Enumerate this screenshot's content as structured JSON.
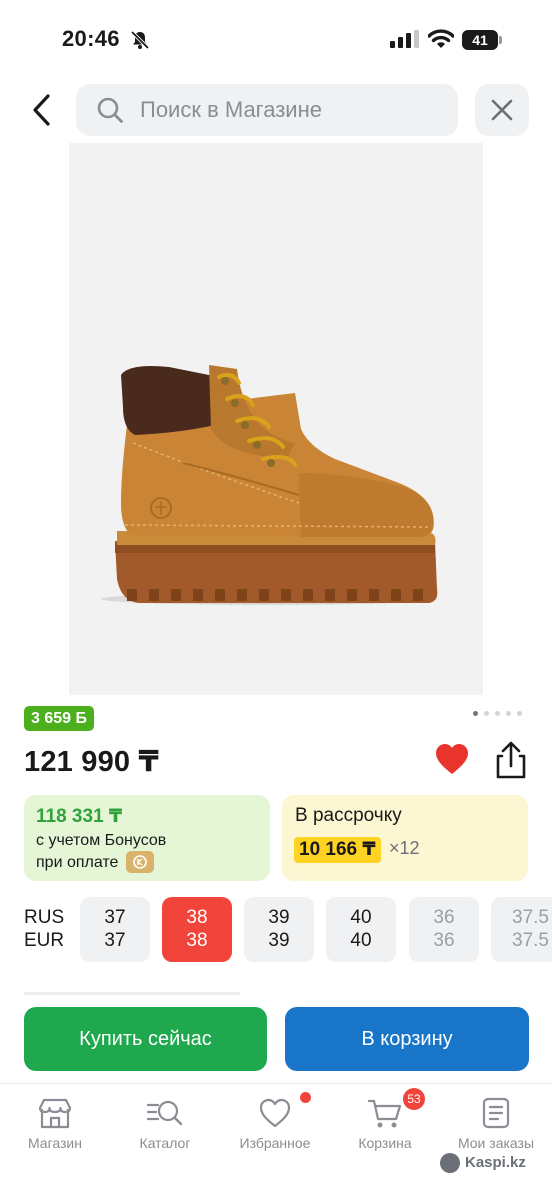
{
  "status_bar": {
    "time": "20:46",
    "battery": "41"
  },
  "search": {
    "placeholder": "Поиск в Магазине"
  },
  "product": {
    "bonus_badge": "3 659 Б",
    "price": "121 990 ₸",
    "gallery_dots": 5,
    "gallery_active": 0
  },
  "bonus_card": {
    "price": "118 331 ₸",
    "line1": "с учетом Бонусов",
    "line2": "при оплате"
  },
  "installment": {
    "title": "В рассрочку",
    "amount": "10 166 ₸",
    "months": "×12"
  },
  "sizes": {
    "label_rus": "RUS",
    "label_eur": "EUR",
    "options": [
      {
        "rus": "37",
        "eur": "37",
        "state": "available"
      },
      {
        "rus": "38",
        "eur": "38",
        "state": "selected"
      },
      {
        "rus": "39",
        "eur": "39",
        "state": "available"
      },
      {
        "rus": "40",
        "eur": "40",
        "state": "available"
      },
      {
        "rus": "36",
        "eur": "36",
        "state": "unavailable"
      },
      {
        "rus": "37.5",
        "eur": "37.5",
        "state": "unavailable"
      }
    ]
  },
  "actions": {
    "buy_now": "Купить сейчас",
    "add_to_cart": "В корзину"
  },
  "nav": {
    "items": [
      {
        "label": "Магазин",
        "icon": "store-icon"
      },
      {
        "label": "Каталог",
        "icon": "catalog-search-icon"
      },
      {
        "label": "Избранное",
        "icon": "heart-outline-icon"
      },
      {
        "label": "Корзина",
        "icon": "cart-icon",
        "badge": "53"
      },
      {
        "label": "Мои заказы",
        "icon": "orders-icon"
      }
    ]
  },
  "watermark": "Kaspi.kz",
  "colors": {
    "accent_red": "#f1443a",
    "buy_green": "#20a84f",
    "cart_blue": "#1875c8",
    "bonus_green": "#4caf1e",
    "installment_yellow": "#ffd324"
  }
}
